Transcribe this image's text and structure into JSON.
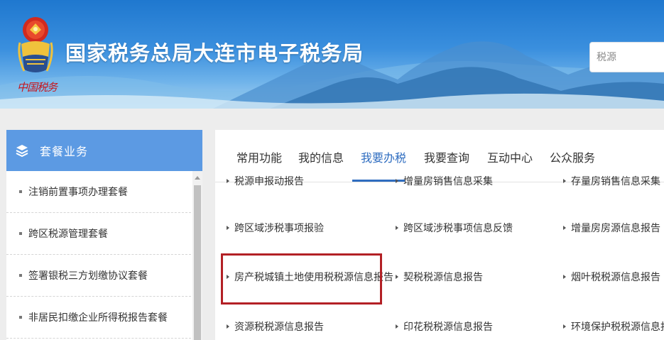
{
  "header": {
    "emblem_signature": "中国税务",
    "site_title": "国家税务总局大连市电子税务局",
    "search_placeholder": "税源"
  },
  "sidebar": {
    "title": "套餐业务",
    "items": [
      {
        "label": "注销前置事项办理套餐"
      },
      {
        "label": "跨区税源管理套餐"
      },
      {
        "label": "签署银税三方划缴协议套餐"
      },
      {
        "label": "非居民扣缴企业所得税报告套餐"
      }
    ]
  },
  "tabs": [
    {
      "label": "常用功能"
    },
    {
      "label": "我的信息"
    },
    {
      "label": "我要办税",
      "active": true
    },
    {
      "label": "我要查询"
    },
    {
      "label": "互动中心"
    },
    {
      "label": "公众服务"
    }
  ],
  "grid": {
    "partial_row": [
      "税源申报动报告",
      "增量房销售信息采集",
      "存量房销售信息采集"
    ],
    "rows": [
      [
        "跨区域涉税事项报验",
        "跨区域涉税事项信息反馈",
        "增量房房源信息报告"
      ],
      [
        "房产税城镇土地使用税税源信息报告",
        "契税税源信息报告",
        "烟叶税税源信息报告"
      ],
      [
        "资源税税源信息报告",
        "印花税税源信息报告",
        "环境保护税税源信息报告"
      ]
    ],
    "highlighted": "房产税城镇土地使用税税源信息报告"
  },
  "colors": {
    "banner_top": "#1f78cf",
    "sidebar_header": "#5c9ae3",
    "active_tab": "#2f6dc0",
    "highlight_border": "#b32025"
  }
}
